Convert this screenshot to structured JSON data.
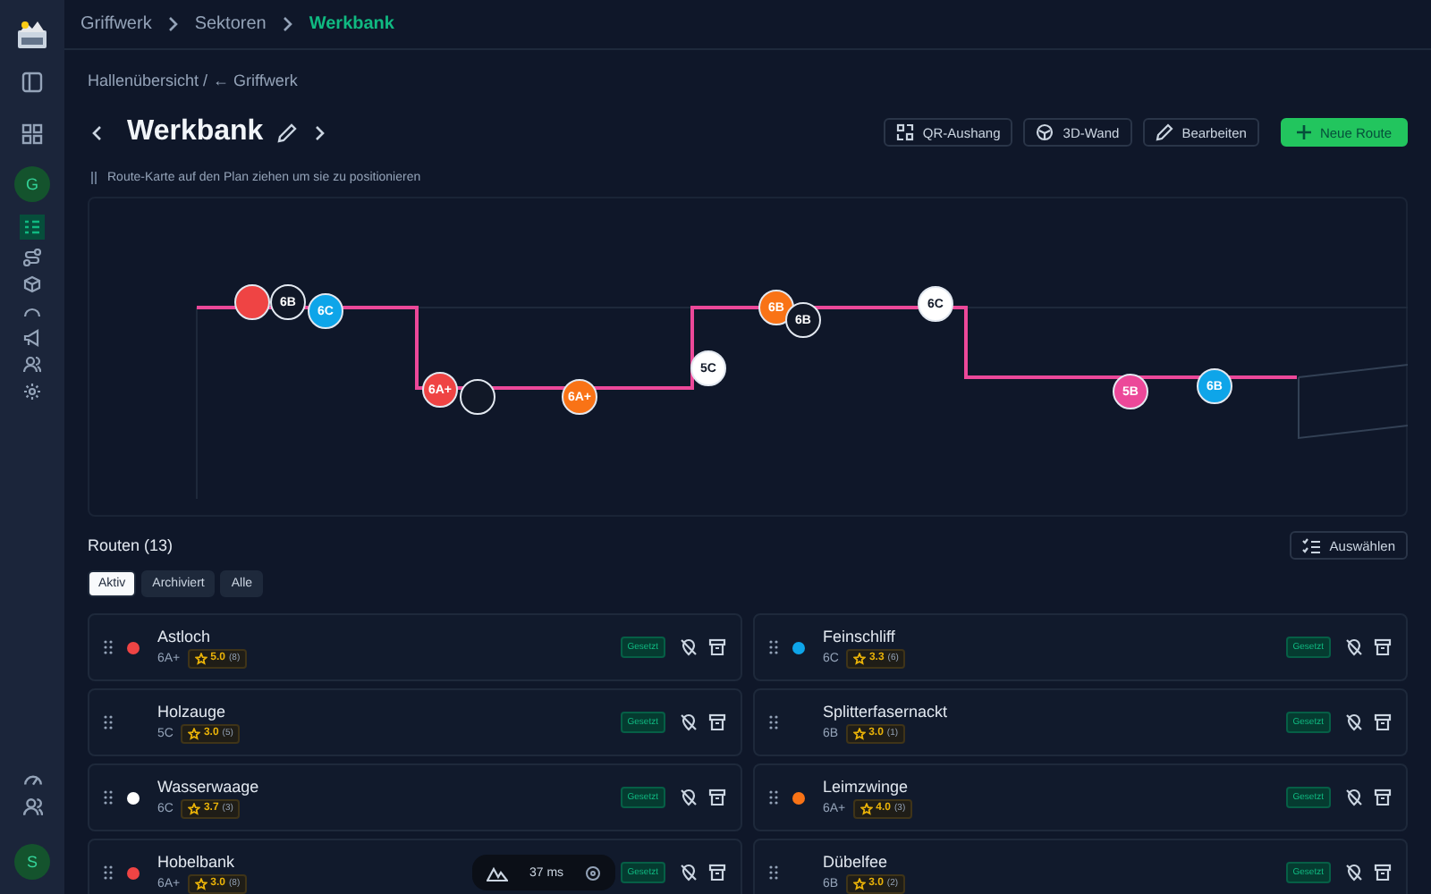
{
  "breadcrumbs": [
    {
      "label": "Griffwerk",
      "selected": false
    },
    {
      "label": "Sektoren",
      "selected": false
    },
    {
      "label": "Werkbank",
      "selected": true
    }
  ],
  "back_path": {
    "parent": "Hallenübersicht /",
    "link": "← Griffwerk"
  },
  "title": "Werkbank",
  "actions": [
    "QR-Aushang",
    "3D-Wand",
    "Bearbeiten"
  ],
  "primary_action": "Neue Route",
  "hint": "Route-Karte auf den Plan ziehen um sie zu positionieren",
  "map_pins": [
    {
      "color": "#ef4444"
    },
    {
      "label": "6B",
      "color": "#111827"
    },
    {
      "label": "6C",
      "color": "#0ea5e9"
    },
    {
      "label": "6A+",
      "color": "#ef4444"
    },
    {
      "color": "#111827"
    },
    {
      "label": "6A+",
      "color": "#f97316"
    },
    {
      "label": "5C",
      "color": "#ffffff"
    },
    {
      "label": "6B",
      "color": "#f97316"
    },
    {
      "label": "6B",
      "color": "#111827"
    },
    {
      "label": "6C",
      "color": "#ffffff"
    },
    {
      "label": "5B",
      "color": "#ec4899"
    },
    {
      "label": "6B",
      "color": "#0ea5e9"
    }
  ],
  "routes_heading": "Routen (13)",
  "select_button": "Auswählen",
  "filters": [
    {
      "label": "Aktiv",
      "selected": true
    },
    {
      "label": "Archiviert",
      "selected": false
    },
    {
      "label": "Alle",
      "selected": false
    }
  ],
  "routes": [
    {
      "name": "Astloch",
      "grade": "6A+",
      "rating": "5.0",
      "count": "(8)",
      "status": "Gesetzt",
      "color": "#ef4444"
    },
    {
      "name": "Feinschliff",
      "grade": "6C",
      "rating": "3.3",
      "count": "(6)",
      "status": "Gesetzt",
      "color": "#0ea5e9"
    },
    {
      "name": "Holzauge",
      "grade": "5C",
      "rating": "3.0",
      "count": "(5)",
      "status": "Gesetzt"
    },
    {
      "name": "Splitterfasernackt",
      "grade": "6B",
      "rating": "3.0",
      "count": "(1)",
      "status": "Gesetzt"
    },
    {
      "name": "Wasserwaage",
      "grade": "6C",
      "rating": "3.7",
      "count": "(3)",
      "status": "Gesetzt",
      "color": "#ffffff"
    },
    {
      "name": "Leimzwinge",
      "grade": "6A+",
      "rating": "4.0",
      "count": "(3)",
      "status": "Gesetzt",
      "color": "#f97316"
    },
    {
      "name": "Hobelbank",
      "grade": "6A+",
      "rating": "3.0",
      "count": "(8)",
      "status": "Gesetzt",
      "color": "#ef4444"
    },
    {
      "name": "Dübelfee",
      "grade": "6B",
      "rating": "3.0",
      "count": "(2)",
      "status": "Gesetzt"
    }
  ],
  "sidebar": {
    "avatar_top": "G",
    "avatar_bottom": "S"
  },
  "dev_toolbar": {
    "timing": "37 ms"
  }
}
